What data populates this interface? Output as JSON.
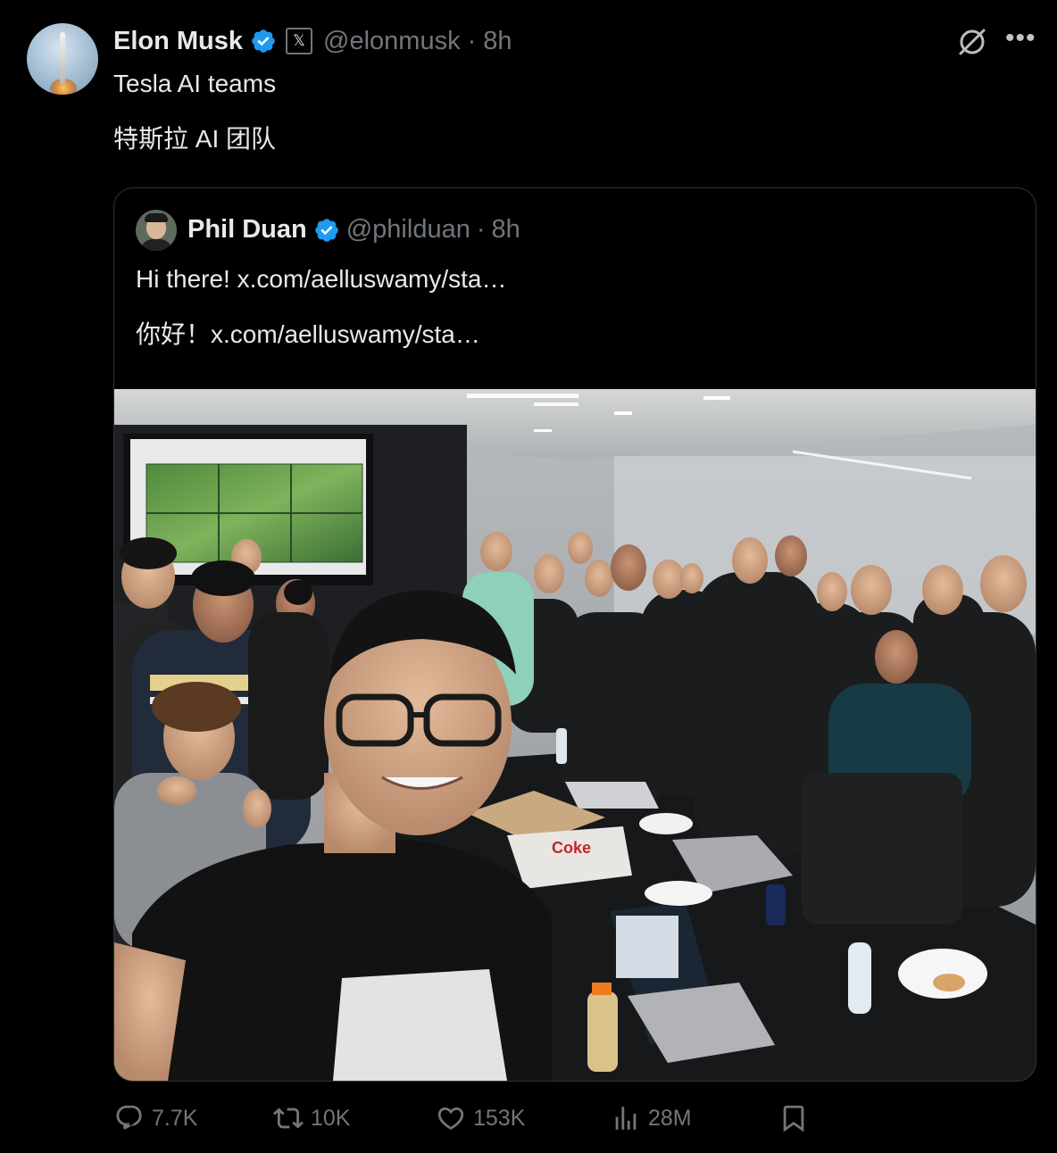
{
  "post": {
    "author": {
      "display_name": "Elon Musk",
      "handle": "@elonmusk",
      "affiliate_badge": "𝕏",
      "verified": true
    },
    "separator": "·",
    "time": "8h",
    "text_lines": [
      "Tesla AI teams",
      "特斯拉 AI 团队"
    ]
  },
  "quote": {
    "author": {
      "display_name": "Phil Duan",
      "handle": "@philduan",
      "verified": true
    },
    "separator": "·",
    "time": "8h",
    "lines": [
      {
        "prefix": "Hi there!",
        "link": "x.com/aelluswamy/sta…"
      },
      {
        "prefix": "你好！",
        "link": "x.com/aelluswamy/sta…"
      }
    ]
  },
  "actions": {
    "replies": "7.7K",
    "reposts": "10K",
    "likes": "153K",
    "views": "28M"
  },
  "icons": [
    "verified-icon",
    "grok-icon",
    "more-icon",
    "reply-icon",
    "repost-icon",
    "like-icon",
    "views-icon",
    "bookmark-icon"
  ],
  "colors": {
    "background": "#000000",
    "text": "#e7e9ea",
    "muted": "#71767b",
    "verified": "#1d9bf0",
    "border": "#2f3336"
  }
}
